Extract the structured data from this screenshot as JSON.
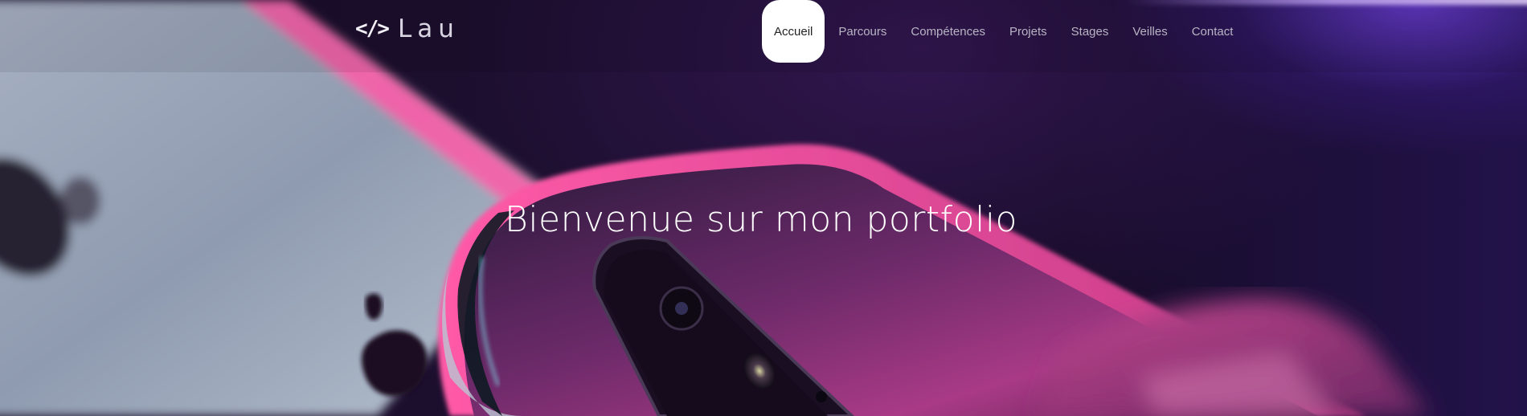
{
  "brand": {
    "logo_icon": "</>",
    "logo_text": "Lau"
  },
  "nav": {
    "items": [
      {
        "label": "Accueil",
        "active": true
      },
      {
        "label": "Parcours",
        "active": false
      },
      {
        "label": "Compétences",
        "active": false
      },
      {
        "label": "Projets",
        "active": false
      },
      {
        "label": "Stages",
        "active": false
      },
      {
        "label": "Veilles",
        "active": false
      },
      {
        "label": "Contact",
        "active": false
      }
    ]
  },
  "hero": {
    "title": "Bienvenue sur mon portfolio",
    "background_image": "phones-gradient-photo"
  },
  "colors": {
    "background_dark": "#120a20",
    "accent_pink": "#d9469a",
    "accent_purple": "#7a4cf0",
    "nav_active_bg": "#ffffff",
    "nav_text": "#b8b4c4"
  }
}
